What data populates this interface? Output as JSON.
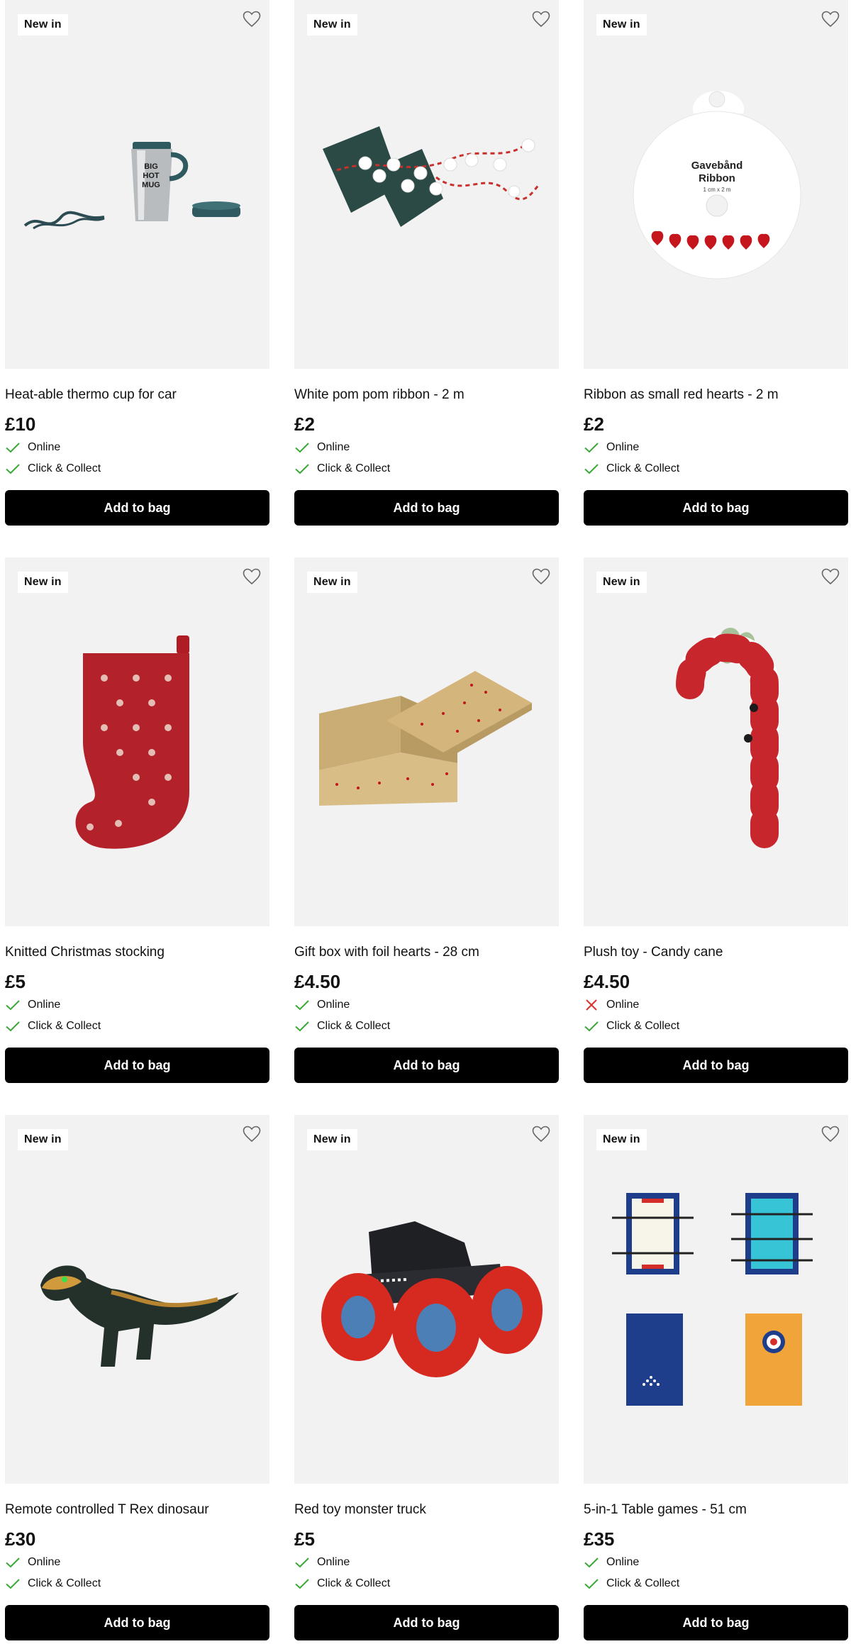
{
  "products": [
    {
      "badge": "New in",
      "title": "Heat-able thermo cup for car",
      "price": "£10",
      "online_label": "Online",
      "online_ok": true,
      "collect_label": "Click & Collect",
      "collect_ok": true,
      "button": "Add to bag",
      "art": "thermo-cup",
      "mug_text": "BIG\nHOT\nMUG"
    },
    {
      "badge": "New in",
      "title": "White pom pom ribbon - 2 m",
      "price": "£2",
      "online_label": "Online",
      "online_ok": true,
      "collect_label": "Click & Collect",
      "collect_ok": true,
      "button": "Add to bag",
      "art": "pompom-ribbon"
    },
    {
      "badge": "New in",
      "title": "Ribbon as small red hearts - 2 m",
      "price": "£2",
      "online_label": "Online",
      "online_ok": true,
      "collect_label": "Click & Collect",
      "collect_ok": true,
      "button": "Add to bag",
      "art": "heart-ribbon",
      "spool_line1": "Gavebånd",
      "spool_line2": "Ribbon",
      "spool_line3": "1 cm x 2 m"
    },
    {
      "badge": "New in",
      "title": "Knitted Christmas stocking",
      "price": "£5",
      "online_label": "Online",
      "online_ok": true,
      "collect_label": "Click & Collect",
      "collect_ok": true,
      "button": "Add to bag",
      "art": "stocking"
    },
    {
      "badge": "New in",
      "title": "Gift box with foil hearts - 28 cm",
      "price": "£4.50",
      "online_label": "Online",
      "online_ok": true,
      "collect_label": "Click & Collect",
      "collect_ok": true,
      "button": "Add to bag",
      "art": "gift-box"
    },
    {
      "badge": "New in",
      "title": "Plush toy - Candy cane",
      "price": "£4.50",
      "online_label": "Online",
      "online_ok": false,
      "collect_label": "Click & Collect",
      "collect_ok": true,
      "button": "Add to bag",
      "art": "candy-cane"
    },
    {
      "badge": "New in",
      "title": "Remote controlled T Rex dinosaur",
      "price": "£30",
      "online_label": "Online",
      "online_ok": true,
      "collect_label": "Click & Collect",
      "collect_ok": true,
      "button": "Add to bag",
      "art": "trex"
    },
    {
      "badge": "New in",
      "title": "Red toy monster truck",
      "price": "£5",
      "online_label": "Online",
      "online_ok": true,
      "collect_label": "Click & Collect",
      "collect_ok": true,
      "button": "Add to bag",
      "art": "monster-truck"
    },
    {
      "badge": "New in",
      "title": "5-in-1 Table games - 51 cm",
      "price": "£35",
      "online_label": "Online",
      "online_ok": true,
      "collect_label": "Click & Collect",
      "collect_ok": true,
      "button": "Add to bag",
      "art": "table-games"
    }
  ],
  "colors": {
    "check": "#3aa935",
    "cross": "#d6332b",
    "button_bg": "#000000",
    "image_bg": "#f2f2f2"
  },
  "icons": {
    "favourite": "heart-outline-icon",
    "available": "checkmark-icon",
    "unavailable": "cross-icon"
  }
}
